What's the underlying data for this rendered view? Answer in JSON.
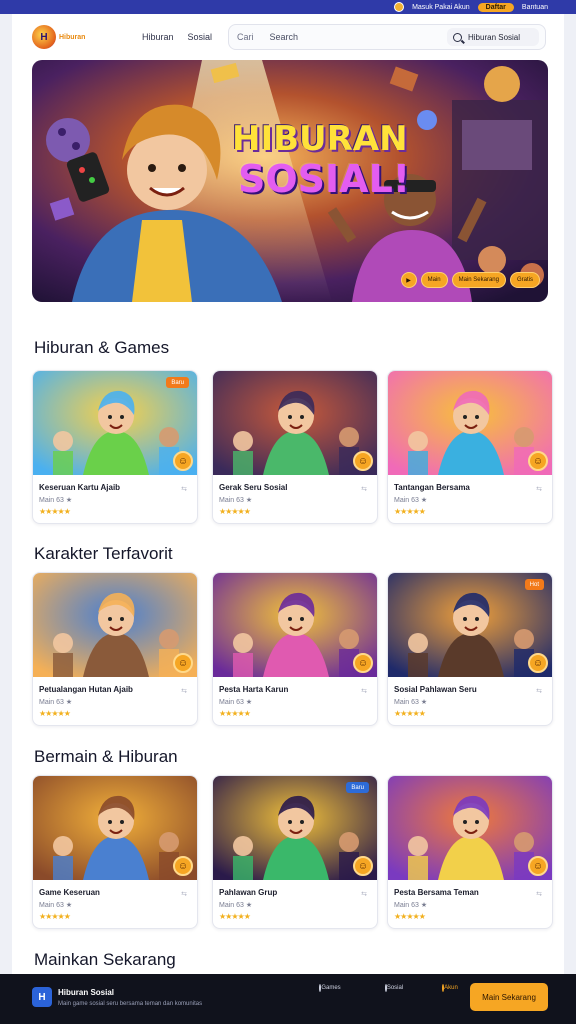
{
  "topbar": {
    "user_text": "Masuk Pakai Akun",
    "pill_label": "Daftar",
    "right_text": "Bantuan"
  },
  "header": {
    "logo_mark": "H",
    "logo_text": "Hiburan",
    "nav": [
      "Hiburan",
      "Sosial"
    ],
    "search_left": "Cari",
    "search_placeholder": "Search",
    "search_button_label": "Hiburan Sosial"
  },
  "hero": {
    "title_line1": "HIBURAN",
    "title_line2": "SOSIAL!",
    "action_1": "Main",
    "action_2": "Main Sekarang",
    "action_3": "Gratis"
  },
  "sections": [
    {
      "title": "Hiburan & Games",
      "cards": [
        {
          "title": "Keseruan Kartu Ajaib",
          "sub": "Main 63 ★",
          "stars": "★★★★★",
          "tag": "Baru",
          "tag_color": "orange",
          "theme": "a"
        },
        {
          "title": "Gerak Seru Sosial",
          "sub": "Main 63 ★",
          "stars": "★★★★★",
          "tag": "",
          "tag_color": "",
          "theme": "b"
        },
        {
          "title": "Tantangan Bersama",
          "sub": "Main 63 ★",
          "stars": "★★★★★",
          "tag": "",
          "tag_color": "",
          "theme": "c"
        }
      ]
    },
    {
      "title": "Karakter Terfavorit",
      "cards": [
        {
          "title": "Petualangan Hutan Ajaib",
          "sub": "Main 63 ★",
          "stars": "★★★★★",
          "tag": "",
          "tag_color": "",
          "theme": "d"
        },
        {
          "title": "Pesta Harta Karun",
          "sub": "Main 63 ★",
          "stars": "★★★★★",
          "tag": "",
          "tag_color": "",
          "theme": "e"
        },
        {
          "title": "Sosial Pahlawan Seru",
          "sub": "Main 63 ★",
          "stars": "★★★★★",
          "tag": "Hot",
          "tag_color": "orange",
          "theme": "f"
        }
      ]
    },
    {
      "title": "Bermain & Hiburan",
      "cards": [
        {
          "title": "Game Keseruan",
          "sub": "Main 63 ★",
          "stars": "★★★★★",
          "tag": "",
          "tag_color": "",
          "theme": "g"
        },
        {
          "title": "Pahlawan Grup",
          "sub": "Main 63 ★",
          "stars": "★★★★★",
          "tag": "Baru",
          "tag_color": "blue",
          "theme": "h"
        },
        {
          "title": "Pesta Bersama Teman",
          "sub": "Main 63 ★",
          "stars": "★★★★★",
          "tag": "",
          "tag_color": "",
          "theme": "i"
        }
      ]
    }
  ],
  "partial_section_title": "Mainkan Sekarang",
  "footer": {
    "logo_mark": "H",
    "brand": "Hiburan Sosial",
    "desc": "Main game sosial seru bersama teman dan komunitas",
    "links": [
      "Games",
      "Sosial",
      "Akun"
    ],
    "cta": "Main Sekarang"
  },
  "colors": {
    "accent": "#f6a623",
    "topbar": "#2f3aa8",
    "footer": "#10121c"
  }
}
